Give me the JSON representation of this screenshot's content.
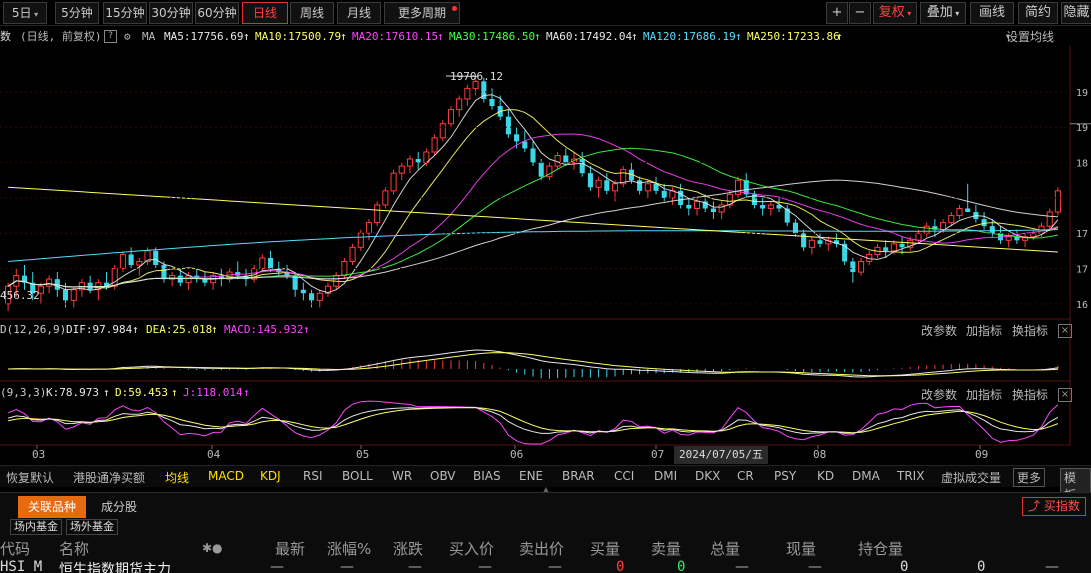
{
  "toolbar": {
    "periods": [
      {
        "label": "5日",
        "active": false
      },
      {
        "label": "5分钟",
        "active": false
      },
      {
        "label": "15分钟",
        "active": false
      },
      {
        "label": "30分钟",
        "active": false
      },
      {
        "label": "60分钟",
        "active": false
      },
      {
        "label": "日线",
        "active": true
      },
      {
        "label": "周线",
        "active": false
      },
      {
        "label": "月线",
        "active": false
      },
      {
        "label": "更多周期",
        "active": false
      }
    ],
    "zoom_in": "+",
    "zoom_out": "−",
    "fuquan": "复权",
    "overlay": "叠加",
    "draw": "画线",
    "simple": "简约",
    "hide": "隐藏"
  },
  "ma_legend": {
    "title": "数",
    "mode": "(日线, 前复权)",
    "help": "?",
    "ma": "MA",
    "items": [
      {
        "text": "MA5:17756.69",
        "color": "#e8e8e8"
      },
      {
        "text": "MA10:17500.79",
        "color": "#ffff66"
      },
      {
        "text": "MA20:17610.15",
        "color": "#ff44ff"
      },
      {
        "text": "MA30:17486.50",
        "color": "#44ff44"
      },
      {
        "text": "MA60:17492.04",
        "color": "#e8e8e8"
      },
      {
        "text": "MA120:17686.19",
        "color": "#55ddff"
      },
      {
        "text": "MA250:17233.86",
        "color": "#ffff66"
      }
    ],
    "settings": "设置均线"
  },
  "macd_legend": {
    "title": "D(12,26,9)",
    "items": [
      {
        "text": "DIF:97.984",
        "color": "#e8e8e8"
      },
      {
        "text": "DEA:25.018",
        "color": "#ffff66"
      },
      {
        "text": "MACD:145.932",
        "color": "#ff44ff"
      }
    ],
    "opt1": "改参数",
    "opt2": "加指标",
    "opt3": "换指标",
    "close": "×"
  },
  "kdj_legend": {
    "title": "(9,3,3)",
    "items": [
      {
        "text": "K:78.973",
        "color": "#e8e8e8"
      },
      {
        "text": "D:59.453",
        "color": "#ffff66"
      },
      {
        "text": "J:118.014",
        "color": "#ff44ff"
      }
    ],
    "opt1": "改参数",
    "opt2": "加指标",
    "opt3": "换指标",
    "close": "×"
  },
  "annotations": {
    "high": "19706.12",
    "low": "456.32"
  },
  "x_axis": {
    "months": [
      "03",
      "04",
      "05",
      "06",
      "07",
      "08",
      "09"
    ],
    "cursor_date": "2024/07/05/五"
  },
  "indicator_tabs": {
    "items": [
      "恢复默认",
      "港股通净买额",
      "均线",
      "MACD",
      "KDJ",
      "RSI",
      "BOLL",
      "WR",
      "OBV",
      "BIAS",
      "ENE",
      "BRAR",
      "CCI",
      "DMI",
      "DKX",
      "CR",
      "PSY",
      "KD",
      "DMA",
      "TRIX",
      "虚拟成交量"
    ],
    "active": [
      "均线",
      "MACD",
      "KDJ"
    ],
    "more": "更多",
    "template": "模板"
  },
  "bottom": {
    "tabs": [
      "关联品种",
      "成分股"
    ],
    "subtabs": [
      "场内基金",
      "场外基金"
    ],
    "buy_index": "买指数",
    "headers": [
      "代码",
      "名称",
      "最新",
      "涨幅%",
      "涨跌",
      "买入价",
      "卖出价",
      "买量",
      "卖量",
      "总量",
      "现量",
      "持仓量"
    ],
    "row": {
      "code": "HSI_M",
      "name": "恒生指数期货主力",
      "buy_qty": "0",
      "sell_qty": "0",
      "cur_qty": "0",
      "hold": "0",
      "dash": "—"
    }
  },
  "chart_data": [
    {
      "type": "candlestick",
      "title": "",
      "x_months": [
        "03",
        "04",
        "05",
        "06",
        "07",
        "08",
        "09"
      ],
      "ylim": [
        16300,
        20150
      ],
      "y_right_ticks_partial": [
        "19",
        "19",
        "18",
        "17",
        "17",
        "16"
      ],
      "ma_values": {
        "MA5": 17756.69,
        "MA10": 17500.79,
        "MA20": 17610.15,
        "MA30": 17486.5,
        "MA60": 17492.04,
        "MA120": 17686.19,
        "MA250": 17233.86
      },
      "annotated_high": 19706.12,
      "colors": {
        "up": "#ff3b3b",
        "down": "#3dd6e6",
        "MA5": "#e8e8e8",
        "MA10": "#ffff66",
        "MA20": "#ff44ff",
        "MA30": "#44ff44",
        "MA60": "#e8e8e8",
        "MA120": "#55ddff",
        "MA250": "#ffff66"
      },
      "candles": [
        {
          "o": 16500,
          "h": 16800,
          "l": 16400,
          "c": 16750
        },
        {
          "o": 16750,
          "h": 17000,
          "l": 16600,
          "c": 16900
        },
        {
          "o": 16900,
          "h": 17050,
          "l": 16700,
          "c": 16800
        },
        {
          "o": 16800,
          "h": 16950,
          "l": 16550,
          "c": 16650
        },
        {
          "o": 16650,
          "h": 16800,
          "l": 16500,
          "c": 16750
        },
        {
          "o": 16750,
          "h": 16900,
          "l": 16650,
          "c": 16850
        },
        {
          "o": 16850,
          "h": 16950,
          "l": 16600,
          "c": 16700
        },
        {
          "o": 16700,
          "h": 16800,
          "l": 16450,
          "c": 16550
        },
        {
          "o": 16550,
          "h": 16750,
          "l": 16450,
          "c": 16700
        },
        {
          "o": 16700,
          "h": 16850,
          "l": 16600,
          "c": 16800
        },
        {
          "o": 16800,
          "h": 16900,
          "l": 16650,
          "c": 16700
        },
        {
          "o": 16700,
          "h": 16850,
          "l": 16550,
          "c": 16800
        },
        {
          "o": 16800,
          "h": 16950,
          "l": 16700,
          "c": 16750
        },
        {
          "o": 16750,
          "h": 17050,
          "l": 16700,
          "c": 17000
        },
        {
          "o": 17000,
          "h": 17250,
          "l": 16950,
          "c": 17200
        },
        {
          "o": 17200,
          "h": 17300,
          "l": 17000,
          "c": 17050
        },
        {
          "o": 17050,
          "h": 17150,
          "l": 16900,
          "c": 17100
        },
        {
          "o": 17100,
          "h": 17300,
          "l": 17050,
          "c": 17250
        },
        {
          "o": 17250,
          "h": 17300,
          "l": 17000,
          "c": 17050
        },
        {
          "o": 17050,
          "h": 17100,
          "l": 16800,
          "c": 16850
        },
        {
          "o": 16850,
          "h": 16950,
          "l": 16750,
          "c": 16900
        },
        {
          "o": 16900,
          "h": 17000,
          "l": 16750,
          "c": 16800
        },
        {
          "o": 16800,
          "h": 16950,
          "l": 16700,
          "c": 16900
        },
        {
          "o": 16900,
          "h": 17000,
          "l": 16800,
          "c": 16850
        },
        {
          "o": 16850,
          "h": 16950,
          "l": 16750,
          "c": 16800
        },
        {
          "o": 16800,
          "h": 16950,
          "l": 16700,
          "c": 16900
        },
        {
          "o": 16900,
          "h": 17000,
          "l": 16750,
          "c": 16850
        },
        {
          "o": 16850,
          "h": 17000,
          "l": 16800,
          "c": 16950
        },
        {
          "o": 16950,
          "h": 17100,
          "l": 16850,
          "c": 16900
        },
        {
          "o": 16900,
          "h": 17000,
          "l": 16750,
          "c": 16850
        },
        {
          "o": 16850,
          "h": 17050,
          "l": 16800,
          "c": 17000
        },
        {
          "o": 17000,
          "h": 17200,
          "l": 16950,
          "c": 17150
        },
        {
          "o": 17150,
          "h": 17250,
          "l": 16950,
          "c": 17000
        },
        {
          "o": 17000,
          "h": 17100,
          "l": 16900,
          "c": 16950
        },
        {
          "o": 16950,
          "h": 17050,
          "l": 16850,
          "c": 16900
        },
        {
          "o": 16900,
          "h": 16950,
          "l": 16600,
          "c": 16700
        },
        {
          "o": 16700,
          "h": 16800,
          "l": 16550,
          "c": 16650
        },
        {
          "o": 16650,
          "h": 16700,
          "l": 16450,
          "c": 16550
        },
        {
          "o": 16550,
          "h": 16700,
          "l": 16450,
          "c": 16650
        },
        {
          "o": 16650,
          "h": 16800,
          "l": 16600,
          "c": 16750
        },
        {
          "o": 16750,
          "h": 16950,
          "l": 16700,
          "c": 16900
        },
        {
          "o": 16900,
          "h": 17150,
          "l": 16850,
          "c": 17100
        },
        {
          "o": 17100,
          "h": 17350,
          "l": 17050,
          "c": 17300
        },
        {
          "o": 17300,
          "h": 17550,
          "l": 17250,
          "c": 17500
        },
        {
          "o": 17500,
          "h": 17700,
          "l": 17400,
          "c": 17650
        },
        {
          "o": 17650,
          "h": 17950,
          "l": 17600,
          "c": 17900
        },
        {
          "o": 17900,
          "h": 18150,
          "l": 17850,
          "c": 18100
        },
        {
          "o": 18100,
          "h": 18400,
          "l": 18050,
          "c": 18350
        },
        {
          "o": 18350,
          "h": 18500,
          "l": 18250,
          "c": 18450
        },
        {
          "o": 18450,
          "h": 18600,
          "l": 18350,
          "c": 18550
        },
        {
          "o": 18550,
          "h": 18650,
          "l": 18400,
          "c": 18500
        },
        {
          "o": 18500,
          "h": 18700,
          "l": 18450,
          "c": 18650
        },
        {
          "o": 18650,
          "h": 18900,
          "l": 18600,
          "c": 18850
        },
        {
          "o": 18850,
          "h": 19100,
          "l": 18800,
          "c": 19050
        },
        {
          "o": 19050,
          "h": 19300,
          "l": 19000,
          "c": 19250
        },
        {
          "o": 19250,
          "h": 19450,
          "l": 19150,
          "c": 19400
        },
        {
          "o": 19400,
          "h": 19600,
          "l": 19300,
          "c": 19550
        },
        {
          "o": 19550,
          "h": 19706,
          "l": 19450,
          "c": 19650
        },
        {
          "o": 19650,
          "h": 19700,
          "l": 19350,
          "c": 19400
        },
        {
          "o": 19400,
          "h": 19550,
          "l": 19250,
          "c": 19300
        },
        {
          "o": 19300,
          "h": 19450,
          "l": 19100,
          "c": 19150
        },
        {
          "o": 19150,
          "h": 19250,
          "l": 18850,
          "c": 18900
        },
        {
          "o": 18900,
          "h": 19000,
          "l": 18700,
          "c": 18800
        },
        {
          "o": 18800,
          "h": 18950,
          "l": 18650,
          "c": 18700
        },
        {
          "o": 18700,
          "h": 18800,
          "l": 18450,
          "c": 18500
        },
        {
          "o": 18500,
          "h": 18550,
          "l": 18250,
          "c": 18300
        },
        {
          "o": 18300,
          "h": 18500,
          "l": 18250,
          "c": 18450
        },
        {
          "o": 18450,
          "h": 18650,
          "l": 18400,
          "c": 18600
        },
        {
          "o": 18600,
          "h": 18700,
          "l": 18450,
          "c": 18500
        },
        {
          "o": 18500,
          "h": 18650,
          "l": 18400,
          "c": 18550
        },
        {
          "o": 18550,
          "h": 18650,
          "l": 18300,
          "c": 18350
        },
        {
          "o": 18350,
          "h": 18450,
          "l": 18100,
          "c": 18150
        },
        {
          "o": 18150,
          "h": 18300,
          "l": 18000,
          "c": 18250
        },
        {
          "o": 18250,
          "h": 18350,
          "l": 18050,
          "c": 18100
        },
        {
          "o": 18100,
          "h": 18250,
          "l": 17950,
          "c": 18200
        },
        {
          "o": 18200,
          "h": 18450,
          "l": 18150,
          "c": 18400
        },
        {
          "o": 18400,
          "h": 18500,
          "l": 18200,
          "c": 18250
        },
        {
          "o": 18250,
          "h": 18300,
          "l": 18050,
          "c": 18100
        },
        {
          "o": 18100,
          "h": 18250,
          "l": 18000,
          "c": 18200
        },
        {
          "o": 18200,
          "h": 18300,
          "l": 18050,
          "c": 18100
        },
        {
          "o": 18100,
          "h": 18200,
          "l": 17950,
          "c": 18000
        },
        {
          "o": 18000,
          "h": 18150,
          "l": 17900,
          "c": 18100
        },
        {
          "o": 18100,
          "h": 18200,
          "l": 17850,
          "c": 17900
        },
        {
          "o": 17900,
          "h": 18000,
          "l": 17750,
          "c": 17850
        },
        {
          "o": 17850,
          "h": 18000,
          "l": 17750,
          "c": 17950
        },
        {
          "o": 17950,
          "h": 18050,
          "l": 17800,
          "c": 17850
        },
        {
          "o": 17850,
          "h": 17950,
          "l": 17700,
          "c": 17800
        },
        {
          "o": 17800,
          "h": 17950,
          "l": 17700,
          "c": 17900
        },
        {
          "o": 17900,
          "h": 18100,
          "l": 17850,
          "c": 18050
        },
        {
          "o": 18050,
          "h": 18300,
          "l": 18000,
          "c": 18250
        },
        {
          "o": 18250,
          "h": 18350,
          "l": 18000,
          "c": 18050
        },
        {
          "o": 18050,
          "h": 18100,
          "l": 17850,
          "c": 17900
        },
        {
          "o": 17900,
          "h": 18000,
          "l": 17750,
          "c": 17850
        },
        {
          "o": 17850,
          "h": 17950,
          "l": 17750,
          "c": 17900
        },
        {
          "o": 17900,
          "h": 18000,
          "l": 17800,
          "c": 17850
        },
        {
          "o": 17850,
          "h": 17900,
          "l": 17600,
          "c": 17650
        },
        {
          "o": 17650,
          "h": 17700,
          "l": 17450,
          "c": 17500
        },
        {
          "o": 17500,
          "h": 17550,
          "l": 17250,
          "c": 17300
        },
        {
          "o": 17300,
          "h": 17450,
          "l": 17200,
          "c": 17400
        },
        {
          "o": 17400,
          "h": 17500,
          "l": 17300,
          "c": 17350
        },
        {
          "o": 17350,
          "h": 17450,
          "l": 17250,
          "c": 17400
        },
        {
          "o": 17400,
          "h": 17500,
          "l": 17300,
          "c": 17350
        },
        {
          "o": 17350,
          "h": 17400,
          "l": 17050,
          "c": 17100
        },
        {
          "o": 17100,
          "h": 17150,
          "l": 16800,
          "c": 16950
        },
        {
          "o": 16950,
          "h": 17150,
          "l": 16900,
          "c": 17100
        },
        {
          "o": 17100,
          "h": 17250,
          "l": 17050,
          "c": 17200
        },
        {
          "o": 17200,
          "h": 17350,
          "l": 17150,
          "c": 17300
        },
        {
          "o": 17300,
          "h": 17400,
          "l": 17150,
          "c": 17250
        },
        {
          "o": 17250,
          "h": 17400,
          "l": 17200,
          "c": 17350
        },
        {
          "o": 17350,
          "h": 17450,
          "l": 17200,
          "c": 17300
        },
        {
          "o": 17300,
          "h": 17450,
          "l": 17250,
          "c": 17400
        },
        {
          "o": 17400,
          "h": 17550,
          "l": 17350,
          "c": 17500
        },
        {
          "o": 17500,
          "h": 17650,
          "l": 17450,
          "c": 17600
        },
        {
          "o": 17600,
          "h": 17700,
          "l": 17450,
          "c": 17550
        },
        {
          "o": 17550,
          "h": 17700,
          "l": 17500,
          "c": 17650
        },
        {
          "o": 17650,
          "h": 17800,
          "l": 17600,
          "c": 17750
        },
        {
          "o": 17750,
          "h": 17900,
          "l": 17700,
          "c": 17850
        },
        {
          "o": 17850,
          "h": 18200,
          "l": 17800,
          "c": 17800
        },
        {
          "o": 17800,
          "h": 17900,
          "l": 17650,
          "c": 17700
        },
        {
          "o": 17700,
          "h": 17800,
          "l": 17550,
          "c": 17600
        },
        {
          "o": 17600,
          "h": 17700,
          "l": 17450,
          "c": 17500
        },
        {
          "o": 17500,
          "h": 17600,
          "l": 17350,
          "c": 17400
        },
        {
          "o": 17400,
          "h": 17500,
          "l": 17300,
          "c": 17450
        },
        {
          "o": 17450,
          "h": 17550,
          "l": 17350,
          "c": 17400
        },
        {
          "o": 17400,
          "h": 17500,
          "l": 17300,
          "c": 17450
        },
        {
          "o": 17450,
          "h": 17550,
          "l": 17400,
          "c": 17500
        },
        {
          "o": 17500,
          "h": 17650,
          "l": 17450,
          "c": 17600
        },
        {
          "o": 17600,
          "h": 17850,
          "l": 17550,
          "c": 17800
        },
        {
          "o": 17800,
          "h": 18150,
          "l": 17750,
          "c": 18100
        }
      ]
    },
    {
      "type": "macd",
      "series": [
        {
          "name": "DIF",
          "value": 97.984
        },
        {
          "name": "DEA",
          "value": 25.018
        },
        {
          "name": "MACD",
          "value": 145.932
        }
      ]
    },
    {
      "type": "kdj",
      "series": [
        {
          "name": "K",
          "value": 78.973
        },
        {
          "name": "D",
          "value": 59.453
        },
        {
          "name": "J",
          "value": 118.014
        }
      ]
    }
  ]
}
